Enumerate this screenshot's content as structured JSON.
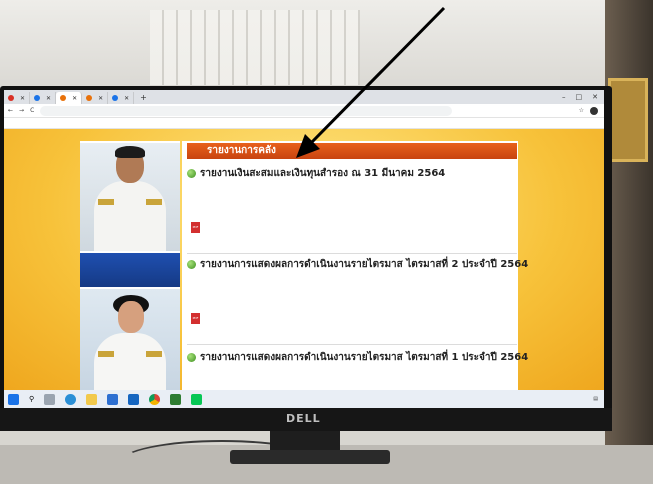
{
  "browser": {
    "tabs": [
      {
        "title": "",
        "color": "#d93025"
      },
      {
        "title": "",
        "color": "#1a73e8"
      },
      {
        "title": "",
        "color": "#e8710a"
      },
      {
        "title": "",
        "color": "#e8710a"
      },
      {
        "title": "",
        "color": "#1a73e8"
      }
    ],
    "new_tab_glyph": "+",
    "url": "",
    "nav_glyphs": {
      "back": "←",
      "forward": "→",
      "reload": "C"
    },
    "bookmarks": []
  },
  "site": {
    "nav_items": [],
    "section_title": "รายงานการคลัง",
    "person1_name": "",
    "person1_position": "",
    "reports": [
      {
        "title": "รายงานเงินสะสมและเงินทุนสำรอง ณ 31 มีนาคม 2564",
        "date": "",
        "description": "",
        "attachments_label": "",
        "file": ""
      },
      {
        "title": "รายงานการแสดงผลการดำเนินงานรายไตรมาส ไตรมาสที่ 2 ประจำปี 2564",
        "date": "",
        "description": "",
        "attachments_label": "",
        "file": ""
      },
      {
        "title": "รายงานการแสดงผลการดำเนินงานรายไตรมาส ไตรมาสที่ 1 ประจำปี 2564",
        "date": "",
        "description": ""
      }
    ]
  },
  "taskbar": {
    "tray_text": "",
    "time": "",
    "date": ""
  },
  "monitor": {
    "brand": "DELL"
  },
  "colors": {
    "section_header": "#d9541a",
    "page_bg": "#f7c23a",
    "namecard": "#1f4fb0"
  }
}
